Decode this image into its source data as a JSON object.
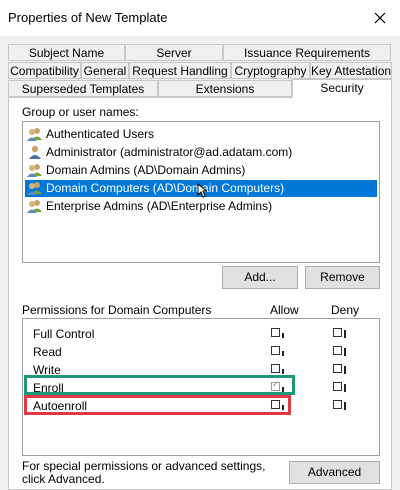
{
  "window": {
    "title": "Properties of New Template"
  },
  "tabs": {
    "row1": [
      "Subject Name",
      "Server",
      "Issuance Requirements"
    ],
    "row2": [
      "Compatibility",
      "General",
      "Request Handling",
      "Cryptography",
      "Key Attestation"
    ],
    "row3": [
      "Superseded Templates",
      "Extensions",
      "Security"
    ],
    "active": "Security"
  },
  "security": {
    "group_label": "Group or user names:",
    "users": [
      {
        "name": "Authenticated Users",
        "icon": "users-group-icon",
        "selected": false
      },
      {
        "name": "Administrator (administrator@ad.adatam.com)",
        "icon": "user-icon",
        "selected": false
      },
      {
        "name": "Domain Admins (AD\\Domain Admins)",
        "icon": "users-group-icon",
        "selected": false
      },
      {
        "name": "Domain Computers (AD\\Domain Computers)",
        "icon": "users-group-icon",
        "selected": true
      },
      {
        "name": "Enterprise Admins (AD\\Enterprise Admins)",
        "icon": "users-group-icon",
        "selected": false
      }
    ],
    "add_button": "Add...",
    "remove_button": "Remove",
    "permissions_label": "Permissions for Domain Computers",
    "allow_header": "Allow",
    "deny_header": "Deny",
    "permissions": [
      {
        "name": "Full Control",
        "allow": false,
        "deny": false
      },
      {
        "name": "Read",
        "allow": false,
        "deny": false
      },
      {
        "name": "Write",
        "allow": false,
        "deny": false
      },
      {
        "name": "Enroll",
        "allow": true,
        "deny": false
      },
      {
        "name": "Autoenroll",
        "allow": false,
        "deny": false
      }
    ],
    "special_text": "For special permissions or advanced settings, click Advanced.",
    "advanced_button": "Advanced"
  },
  "colors": {
    "selection": "#0078d7",
    "highlight_enroll": "#1a9a78",
    "highlight_autoenroll": "#e0393f"
  }
}
